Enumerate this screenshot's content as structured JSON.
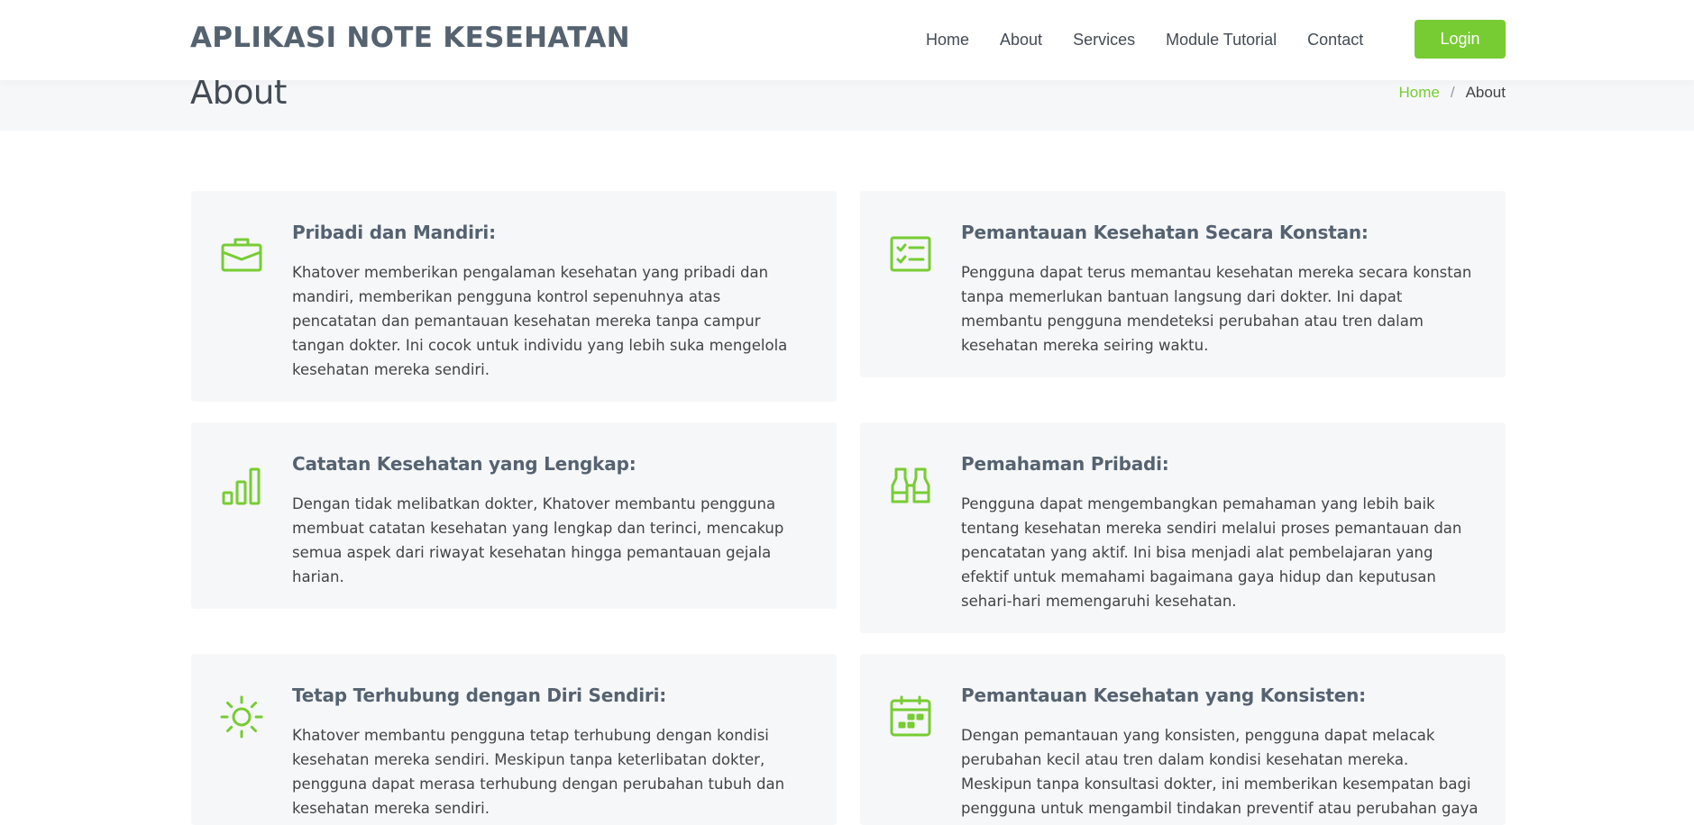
{
  "header": {
    "logo": "APLIKASI NOTE KESEHATAN",
    "nav": [
      "Home",
      "About",
      "Services",
      "Module Tutorial",
      "Contact"
    ],
    "login_label": "Login"
  },
  "breadcrumbs": {
    "title": "About",
    "home": "Home",
    "separator": "/",
    "current": "About"
  },
  "accent_color": "#77cc33",
  "cards": [
    {
      "icon": "briefcase-icon",
      "title": "Pribadi dan Mandiri:",
      "text": "Khatover memberikan pengalaman kesehatan yang pribadi dan mandiri, memberikan pengguna kontrol sepenuhnya atas pencatatan dan pemantauan kesehatan mereka tanpa campur tangan dokter. Ini cocok untuk individu yang lebih suka mengelola kesehatan mereka sendiri."
    },
    {
      "icon": "checklist-icon",
      "title": "Pemantauan Kesehatan Secara Konstan:",
      "text": "Pengguna dapat terus memantau kesehatan mereka secara konstan tanpa memerlukan bantuan langsung dari dokter. Ini dapat membantu pengguna mendeteksi perubahan atau tren dalam kesehatan mereka seiring waktu."
    },
    {
      "icon": "bar-chart-icon",
      "title": "Catatan Kesehatan yang Lengkap:",
      "text": "Dengan tidak melibatkan dokter, Khatover membantu pengguna membuat catatan kesehatan yang lengkap dan terinci, mencakup semua aspek dari riwayat kesehatan hingga pemantauan gejala harian."
    },
    {
      "icon": "binoculars-icon",
      "title": "Pemahaman Pribadi:",
      "text": "Pengguna dapat mengembangkan pemahaman yang lebih baik tentang kesehatan mereka sendiri melalui proses pemantauan dan pencatatan yang aktif. Ini bisa menjadi alat pembelajaran yang efektif untuk memahami bagaimana gaya hidup dan keputusan sehari-hari memengaruhi kesehatan."
    },
    {
      "icon": "sun-icon",
      "title": "Tetap Terhubung dengan Diri Sendiri:",
      "text": "Khatover membantu pengguna tetap terhubung dengan kondisi kesehatan mereka sendiri. Meskipun tanpa keterlibatan dokter, pengguna dapat merasa terhubung dengan perubahan tubuh dan kesehatan mereka sendiri."
    },
    {
      "icon": "calendar-icon",
      "title": "Pemantauan Kesehatan yang Konsisten:",
      "text": "Dengan pemantauan yang konsisten, pengguna dapat melacak perubahan kecil atau tren dalam kondisi kesehatan mereka. Meskipun tanpa konsultasi dokter, ini memberikan kesempatan bagi pengguna untuk mengambil tindakan preventif atau perubahan gaya hidup yang sesuai."
    }
  ]
}
